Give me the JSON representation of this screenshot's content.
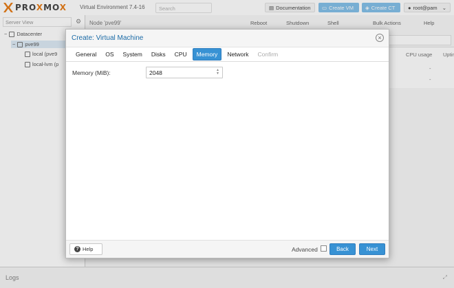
{
  "topbar": {
    "logo_text_a": "PRO",
    "logo_text_x": "X",
    "logo_text_b": "MO",
    "logo_text_x2": "X",
    "version": "Virtual Environment 7.4-16",
    "search_placeholder": "Search",
    "documentation_label": "Documentation",
    "create_vm_label": "Create VM",
    "create_ct_label": "Create CT",
    "user_label": "root@pam"
  },
  "left": {
    "view_label": "Server View",
    "tree": {
      "datacenter": "Datacenter",
      "node": "pve99",
      "storage1": "local (pve9",
      "storage2": "local-lvm (p"
    }
  },
  "content": {
    "node_title": "Node 'pve99'",
    "reboot": "Reboot",
    "shutdown": "Shutdown",
    "shell": "Shell",
    "bulk_actions": "Bulk Actions",
    "help": "Help",
    "col_cpu": "CPU usage",
    "col_uptime": "Uptime",
    "dash1": "-",
    "dash2": "-"
  },
  "dialog": {
    "title": "Create: Virtual Machine",
    "tabs": [
      "General",
      "OS",
      "System",
      "Disks",
      "CPU",
      "Memory",
      "Network",
      "Confirm"
    ],
    "active_tab": "Memory",
    "memory_label": "Memory (MiB):",
    "memory_value": "2048",
    "help_label": "Help",
    "advanced_label": "Advanced",
    "back_label": "Back",
    "next_label": "Next"
  },
  "logs": {
    "label": "Logs"
  },
  "colors": {
    "accent": "#3892d4",
    "title_blue": "#1a6aa6",
    "logo_orange": "#e57000"
  }
}
